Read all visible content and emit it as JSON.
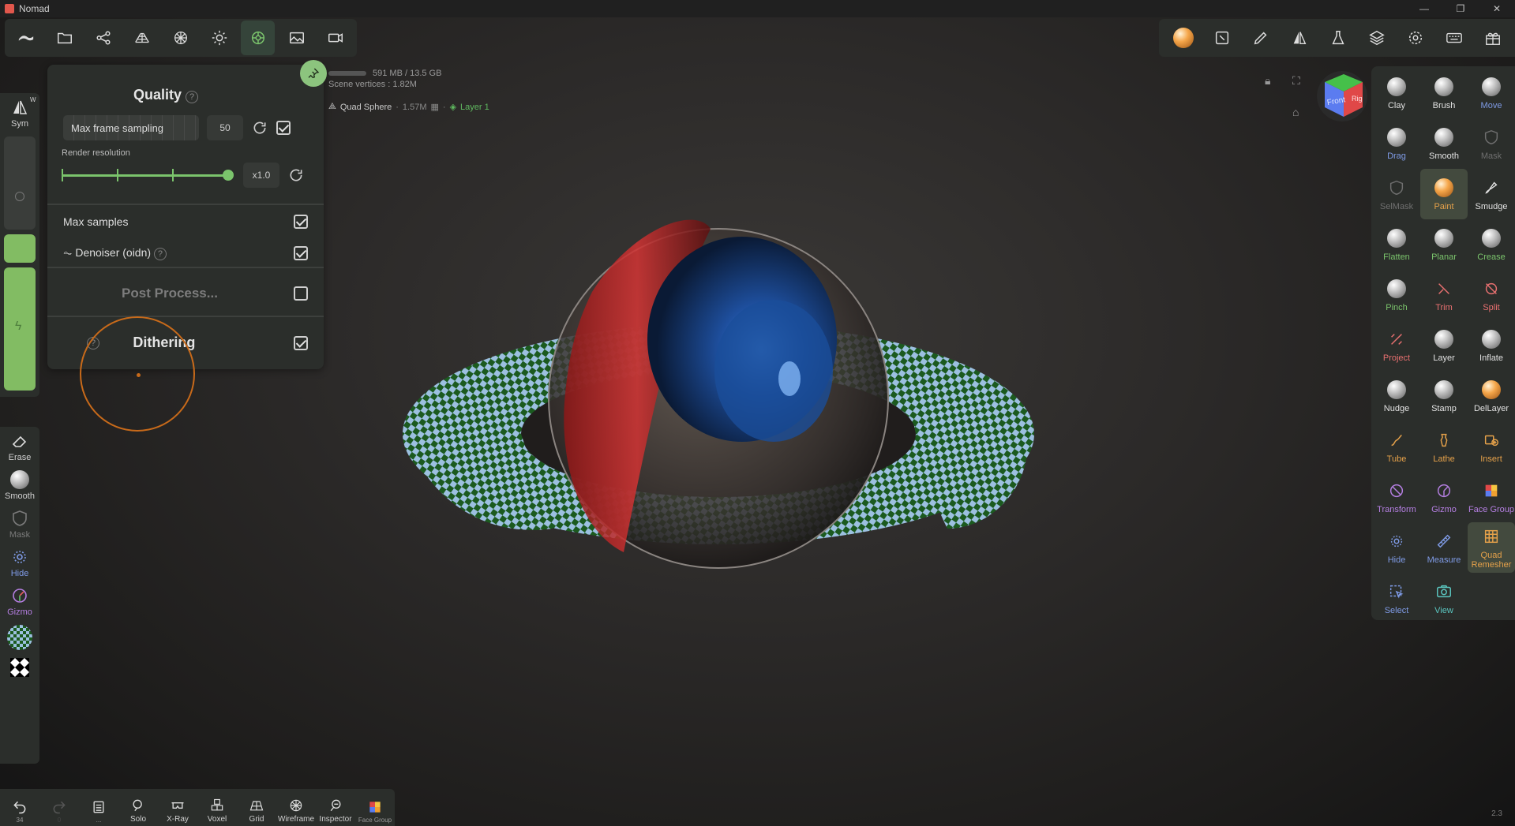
{
  "window": {
    "title": "Nomad"
  },
  "stats": {
    "memory": "591 MB / 13.5 GB",
    "vertices": "Scene vertices : 1.82M"
  },
  "object": {
    "name": "Quad Sphere",
    "verts": "1.57M",
    "sep": "·",
    "layer": "Layer 1"
  },
  "quality_panel": {
    "title": "Quality",
    "max_frame_sampling_label": "Max frame sampling",
    "max_frame_sampling_value": "50",
    "render_resolution_label": "Render resolution",
    "render_resolution_value": "x1.0",
    "render_resolution_level": 1.0,
    "max_samples_label": "Max samples",
    "denoiser_label": "Denoiser (oidn)",
    "post_process_label": "Post Process...",
    "dithering_label": "Dithering",
    "help_glyph": "?"
  },
  "left_strip": {
    "sym_label": "Sym",
    "sym_superscript": "W",
    "tools": [
      {
        "label": "Erase"
      },
      {
        "label": "Smooth"
      },
      {
        "label": "Mask"
      },
      {
        "label": "Hide"
      },
      {
        "label": "Gizmo"
      }
    ]
  },
  "right_tools": [
    {
      "label": "Clay",
      "color": "white",
      "icon": "ball"
    },
    {
      "label": "Brush",
      "color": "white",
      "icon": "ball"
    },
    {
      "label": "Move",
      "color": "blue",
      "icon": "ball"
    },
    {
      "label": "Drag",
      "color": "blue",
      "icon": "ball"
    },
    {
      "label": "Smooth",
      "color": "white",
      "icon": "ball"
    },
    {
      "label": "Mask",
      "color": "gray",
      "icon": "shield"
    },
    {
      "label": "SelMask",
      "color": "gray",
      "icon": "shield"
    },
    {
      "label": "Paint",
      "color": "orange",
      "icon": "ball-orange",
      "active": true
    },
    {
      "label": "Smudge",
      "color": "white",
      "icon": "smudge"
    },
    {
      "label": "Flatten",
      "color": "green",
      "icon": "ball"
    },
    {
      "label": "Planar",
      "color": "green",
      "icon": "ball"
    },
    {
      "label": "Crease",
      "color": "green",
      "icon": "ball"
    },
    {
      "label": "Pinch",
      "color": "green",
      "icon": "ball"
    },
    {
      "label": "Trim",
      "color": "red",
      "icon": "trim"
    },
    {
      "label": "Split",
      "color": "red",
      "icon": "split"
    },
    {
      "label": "Project",
      "color": "red",
      "icon": "project"
    },
    {
      "label": "Layer",
      "color": "white",
      "icon": "ball"
    },
    {
      "label": "Inflate",
      "color": "white",
      "icon": "ball"
    },
    {
      "label": "Nudge",
      "color": "white",
      "icon": "ball"
    },
    {
      "label": "Stamp",
      "color": "white",
      "icon": "ball"
    },
    {
      "label": "DelLayer",
      "color": "white",
      "icon": "ball-orange"
    },
    {
      "label": "Tube",
      "color": "orange",
      "icon": "tube"
    },
    {
      "label": "Lathe",
      "color": "orange",
      "icon": "lathe"
    },
    {
      "label": "Insert",
      "color": "orange",
      "icon": "insert"
    },
    {
      "label": "Transform",
      "color": "violet",
      "icon": "transform"
    },
    {
      "label": "Gizmo",
      "color": "violet",
      "icon": "gizmo"
    },
    {
      "label": "Face Group",
      "color": "violet",
      "icon": "facegroup"
    },
    {
      "label": "Hide",
      "color": "blue",
      "icon": "hide"
    },
    {
      "label": "Measure",
      "color": "blue",
      "icon": "measure"
    },
    {
      "label": "Quad Remesher",
      "color": "orange",
      "icon": "quadremesh",
      "active": true
    },
    {
      "label": "Select",
      "color": "blue",
      "icon": "select"
    },
    {
      "label": "View",
      "color": "teal",
      "icon": "view"
    }
  ],
  "bottom_bar": {
    "undo_count": "34",
    "redo_count": "0",
    "list_dots": "...",
    "items": [
      {
        "label": "Solo"
      },
      {
        "label": "X-Ray"
      },
      {
        "label": "Voxel"
      },
      {
        "label": "Grid"
      },
      {
        "label": "Wireframe"
      },
      {
        "label": "Inspector"
      },
      {
        "label": "Face Group"
      }
    ]
  },
  "gizmo": {
    "front_label": "Front",
    "right_label": "Rig"
  },
  "version": "2.3",
  "colors": {
    "accent": "#7bc46c",
    "panel": "#2b2e2b",
    "cursor": "#c86a1a"
  }
}
